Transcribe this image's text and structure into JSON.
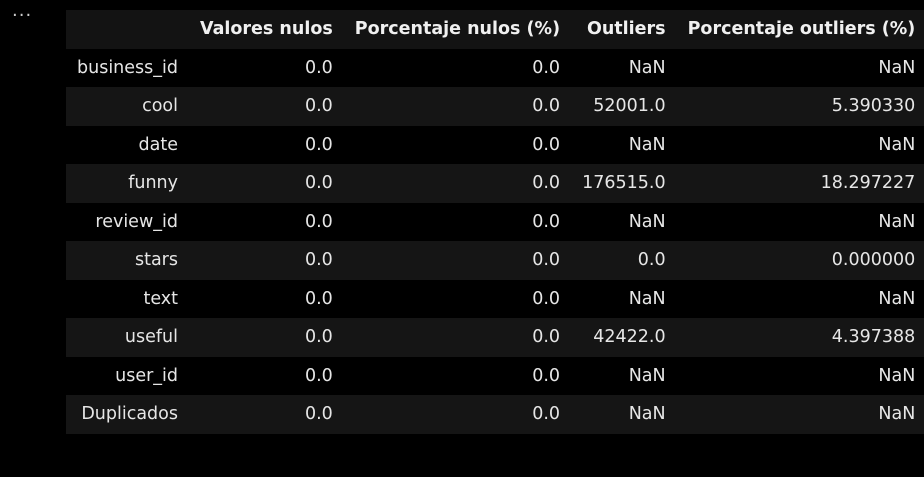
{
  "output_prompt": "···",
  "table": {
    "columns": [
      "",
      "Valores nulos",
      "Porcentaje nulos (%)",
      "Outliers",
      "Porcentaje outliers (%)"
    ],
    "rows": [
      {
        "index": "business_id",
        "cells": [
          "0.0",
          "0.0",
          "NaN",
          "NaN"
        ]
      },
      {
        "index": "cool",
        "cells": [
          "0.0",
          "0.0",
          "52001.0",
          "5.390330"
        ]
      },
      {
        "index": "date",
        "cells": [
          "0.0",
          "0.0",
          "NaN",
          "NaN"
        ]
      },
      {
        "index": "funny",
        "cells": [
          "0.0",
          "0.0",
          "176515.0",
          "18.297227"
        ]
      },
      {
        "index": "review_id",
        "cells": [
          "0.0",
          "0.0",
          "NaN",
          "NaN"
        ]
      },
      {
        "index": "stars",
        "cells": [
          "0.0",
          "0.0",
          "0.0",
          "0.000000"
        ]
      },
      {
        "index": "text",
        "cells": [
          "0.0",
          "0.0",
          "NaN",
          "NaN"
        ]
      },
      {
        "index": "useful",
        "cells": [
          "0.0",
          "0.0",
          "42422.0",
          "4.397388"
        ]
      },
      {
        "index": "user_id",
        "cells": [
          "0.0",
          "0.0",
          "NaN",
          "NaN"
        ]
      },
      {
        "index": "Duplicados",
        "cells": [
          "0.0",
          "0.0",
          "NaN",
          "NaN"
        ]
      }
    ]
  }
}
